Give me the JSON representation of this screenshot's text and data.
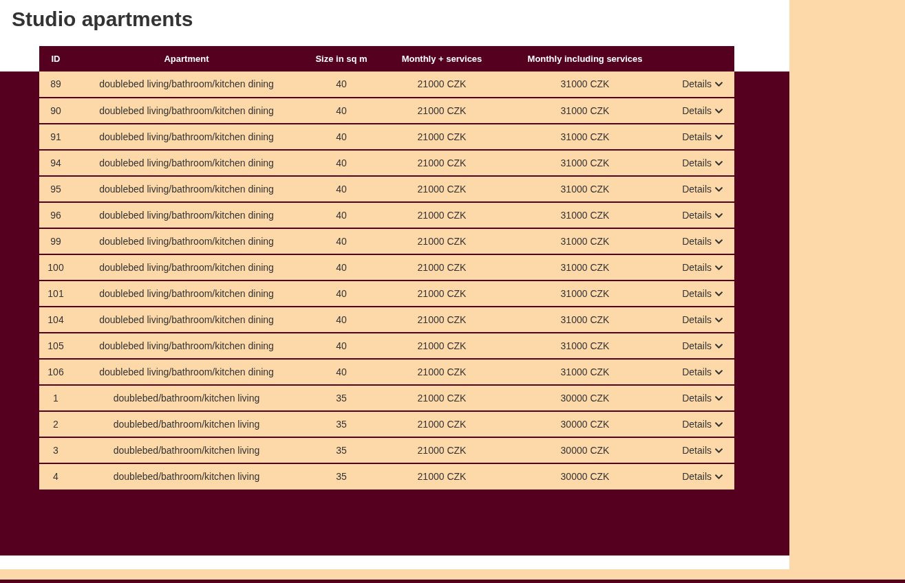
{
  "title": "Studio apartments",
  "table": {
    "columns": [
      "ID",
      "Apartment",
      "Size in sq m",
      "Monthly + services",
      "Monthly including services"
    ],
    "rows": [
      {
        "id": "89",
        "apartment": "doublebed living/bathroom/kitchen dining",
        "size": "40",
        "monthly": "21000 CZK",
        "monthly_incl": "31000 CZK",
        "details": "Details"
      },
      {
        "id": "90",
        "apartment": "doublebed living/bathroom/kitchen dining",
        "size": "40",
        "monthly": "21000 CZK",
        "monthly_incl": "31000 CZK",
        "details": "Details"
      },
      {
        "id": "91",
        "apartment": "doublebed living/bathroom/kitchen dining",
        "size": "40",
        "monthly": "21000 CZK",
        "monthly_incl": "31000 CZK",
        "details": "Details"
      },
      {
        "id": "94",
        "apartment": "doublebed living/bathroom/kitchen dining",
        "size": "40",
        "monthly": "21000 CZK",
        "monthly_incl": "31000 CZK",
        "details": "Details"
      },
      {
        "id": "95",
        "apartment": "doublebed living/bathroom/kitchen dining",
        "size": "40",
        "monthly": "21000 CZK",
        "monthly_incl": "31000 CZK",
        "details": "Details"
      },
      {
        "id": "96",
        "apartment": "doublebed living/bathroom/kitchen dining",
        "size": "40",
        "monthly": "21000 CZK",
        "monthly_incl": "31000 CZK",
        "details": "Details"
      },
      {
        "id": "99",
        "apartment": "doublebed living/bathroom/kitchen dining",
        "size": "40",
        "monthly": "21000 CZK",
        "monthly_incl": "31000 CZK",
        "details": "Details"
      },
      {
        "id": "100",
        "apartment": "doublebed living/bathroom/kitchen dining",
        "size": "40",
        "monthly": "21000 CZK",
        "monthly_incl": "31000 CZK",
        "details": "Details"
      },
      {
        "id": "101",
        "apartment": "doublebed living/bathroom/kitchen dining",
        "size": "40",
        "monthly": "21000 CZK",
        "monthly_incl": "31000 CZK",
        "details": "Details"
      },
      {
        "id": "104",
        "apartment": "doublebed living/bathroom/kitchen dining",
        "size": "40",
        "monthly": "21000 CZK",
        "monthly_incl": "31000 CZK",
        "details": "Details"
      },
      {
        "id": "105",
        "apartment": "doublebed living/bathroom/kitchen dining",
        "size": "40",
        "monthly": "21000 CZK",
        "monthly_incl": "31000 CZK",
        "details": "Details"
      },
      {
        "id": "106",
        "apartment": "doublebed living/bathroom/kitchen dining",
        "size": "40",
        "monthly": "21000 CZK",
        "monthly_incl": "31000 CZK",
        "details": "Details"
      },
      {
        "id": "1",
        "apartment": "doublebed/bathroom/kitchen living",
        "size": "35",
        "monthly": "21000 CZK",
        "monthly_incl": "30000 CZK",
        "details": "Details"
      },
      {
        "id": "2",
        "apartment": "doublebed/bathroom/kitchen living",
        "size": "35",
        "monthly": "21000 CZK",
        "monthly_incl": "30000 CZK",
        "details": "Details"
      },
      {
        "id": "3",
        "apartment": "doublebed/bathroom/kitchen living",
        "size": "35",
        "monthly": "21000 CZK",
        "monthly_incl": "30000 CZK",
        "details": "Details"
      },
      {
        "id": "4",
        "apartment": "doublebed/bathroom/kitchen living",
        "size": "35",
        "monthly": "21000 CZK",
        "monthly_incl": "30000 CZK",
        "details": "Details"
      }
    ]
  }
}
